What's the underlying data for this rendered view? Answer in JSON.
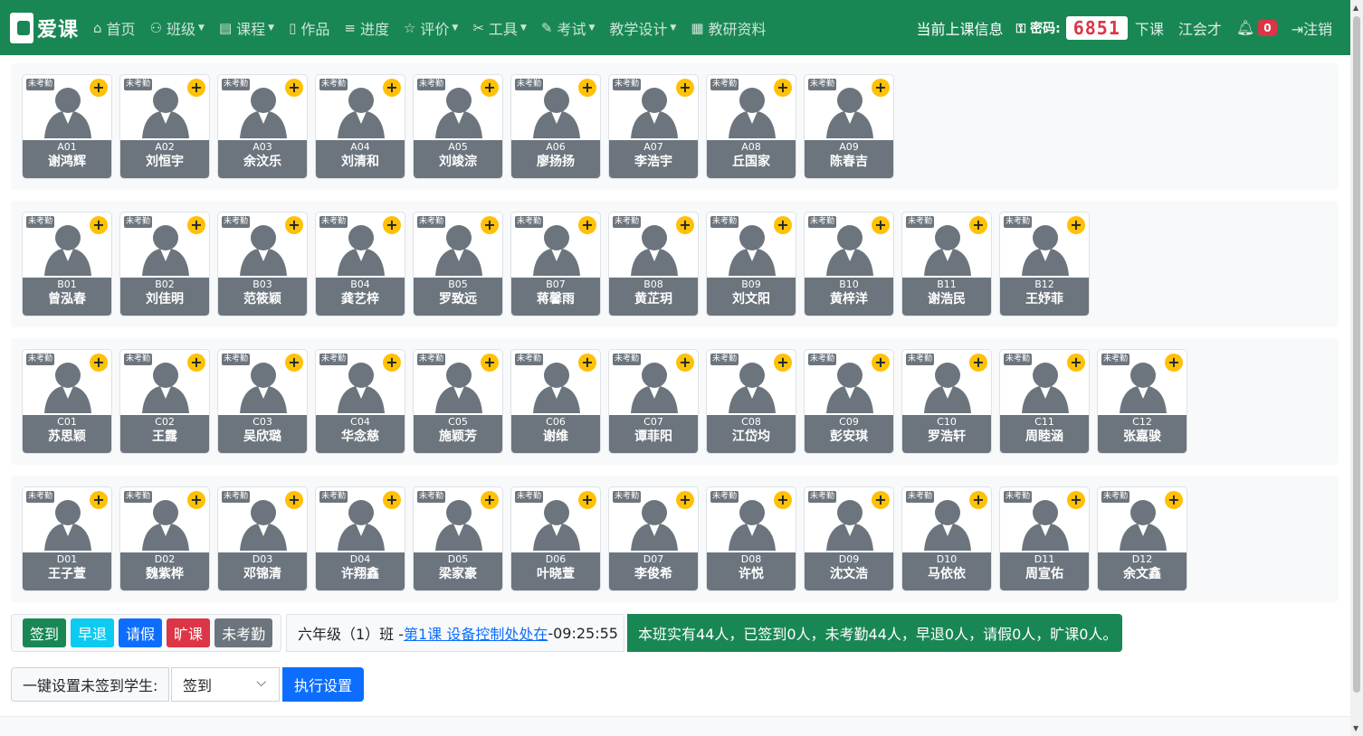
{
  "navbar": {
    "brand": "爱课",
    "items": [
      {
        "label": "首页",
        "icon": "home-icon",
        "glyph": "⌂",
        "caret": false
      },
      {
        "label": "班级",
        "icon": "users-icon",
        "glyph": "⚇",
        "caret": true
      },
      {
        "label": "课程",
        "icon": "course-icon",
        "glyph": "▤",
        "caret": true
      },
      {
        "label": "作品",
        "icon": "book-icon",
        "glyph": "▯",
        "caret": false
      },
      {
        "label": "进度",
        "icon": "list-icon",
        "glyph": "≡",
        "caret": false
      },
      {
        "label": "评价",
        "icon": "star-icon",
        "glyph": "☆",
        "caret": true
      },
      {
        "label": "工具",
        "icon": "tools-icon",
        "glyph": "✂",
        "caret": true
      },
      {
        "label": "考试",
        "icon": "edit-icon",
        "glyph": "✎",
        "caret": true
      },
      {
        "label": "教学设计",
        "icon": "",
        "glyph": "",
        "caret": true
      },
      {
        "label": "教研资料",
        "icon": "document-icon",
        "glyph": "▦",
        "caret": false
      }
    ],
    "current_class_label": "当前上课信息",
    "password_label": "密码:",
    "password": "6851",
    "end_class": "下课",
    "user": "江会才",
    "notifications": "0",
    "logout": "注销"
  },
  "tag_text": "未考勤",
  "plus_text": "+",
  "rows": [
    {
      "students": [
        {
          "code": "A01",
          "name": "谢鸿辉"
        },
        {
          "code": "A02",
          "name": "刘恒宇"
        },
        {
          "code": "A03",
          "name": "余汶乐"
        },
        {
          "code": "A04",
          "name": "刘清和"
        },
        {
          "code": "A05",
          "name": "刘竣淙"
        },
        {
          "code": "A06",
          "name": "廖扬扬"
        },
        {
          "code": "A07",
          "name": "李浩宇"
        },
        {
          "code": "A08",
          "name": "丘国家"
        },
        {
          "code": "A09",
          "name": "陈春吉"
        }
      ]
    },
    {
      "students": [
        {
          "code": "B01",
          "name": "曾泓春"
        },
        {
          "code": "B02",
          "name": "刘佳明"
        },
        {
          "code": "B03",
          "name": "范筱颖"
        },
        {
          "code": "B04",
          "name": "龚艺梓"
        },
        {
          "code": "B05",
          "name": "罗致远"
        },
        {
          "code": "B07",
          "name": "蒋馨雨"
        },
        {
          "code": "B08",
          "name": "黄芷玥"
        },
        {
          "code": "B09",
          "name": "刘文阳"
        },
        {
          "code": "B10",
          "name": "黄梓洋"
        },
        {
          "code": "B11",
          "name": "谢浩民"
        },
        {
          "code": "B12",
          "name": "王妤菲"
        }
      ]
    },
    {
      "students": [
        {
          "code": "C01",
          "name": "苏思颖"
        },
        {
          "code": "C02",
          "name": "王露"
        },
        {
          "code": "C03",
          "name": "吴欣璐"
        },
        {
          "code": "C04",
          "name": "华念慈"
        },
        {
          "code": "C05",
          "name": "施颖芳"
        },
        {
          "code": "C06",
          "name": "谢维"
        },
        {
          "code": "C07",
          "name": "谭菲阳"
        },
        {
          "code": "C08",
          "name": "江岱均"
        },
        {
          "code": "C09",
          "name": "彭安琪"
        },
        {
          "code": "C10",
          "name": "罗浩轩"
        },
        {
          "code": "C11",
          "name": "周睦涵"
        },
        {
          "code": "C12",
          "name": "张嘉骏"
        }
      ]
    },
    {
      "students": [
        {
          "code": "D01",
          "name": "王子萱"
        },
        {
          "code": "D02",
          "name": "魏紫桦"
        },
        {
          "code": "D03",
          "name": "邓锦清"
        },
        {
          "code": "D04",
          "name": "许翔鑫"
        },
        {
          "code": "D05",
          "name": "梁家豪"
        },
        {
          "code": "D06",
          "name": "叶晓萱"
        },
        {
          "code": "D07",
          "name": "李俊希"
        },
        {
          "code": "D08",
          "name": "许悦"
        },
        {
          "code": "D09",
          "name": "沈文浩"
        },
        {
          "code": "D10",
          "name": "马依依"
        },
        {
          "code": "D11",
          "name": "周宣佑"
        },
        {
          "code": "D12",
          "name": "余文鑫"
        }
      ]
    }
  ],
  "status_buttons": [
    {
      "label": "签到",
      "color": "#198754"
    },
    {
      "label": "早退",
      "color": "#0dcaf0"
    },
    {
      "label": "请假",
      "color": "#0d6efd"
    },
    {
      "label": "旷课",
      "color": "#dc3545"
    },
    {
      "label": "未考勤",
      "color": "#6c757d"
    }
  ],
  "class_info": {
    "prefix": "六年级（1）班 -",
    "lesson_link": "第1课 设备控制处处在",
    "time": "-09:25:55"
  },
  "summary": "本班实有44人，已签到0人，未考勤44人，早退0人，请假0人，旷课0人。",
  "set_all": {
    "label": "一键设置未签到学生:",
    "selected": "签到",
    "button": "执行设置"
  },
  "colors": {
    "nav": "#198754",
    "card_footer": "#6c757d",
    "plus": "#ffc107"
  }
}
